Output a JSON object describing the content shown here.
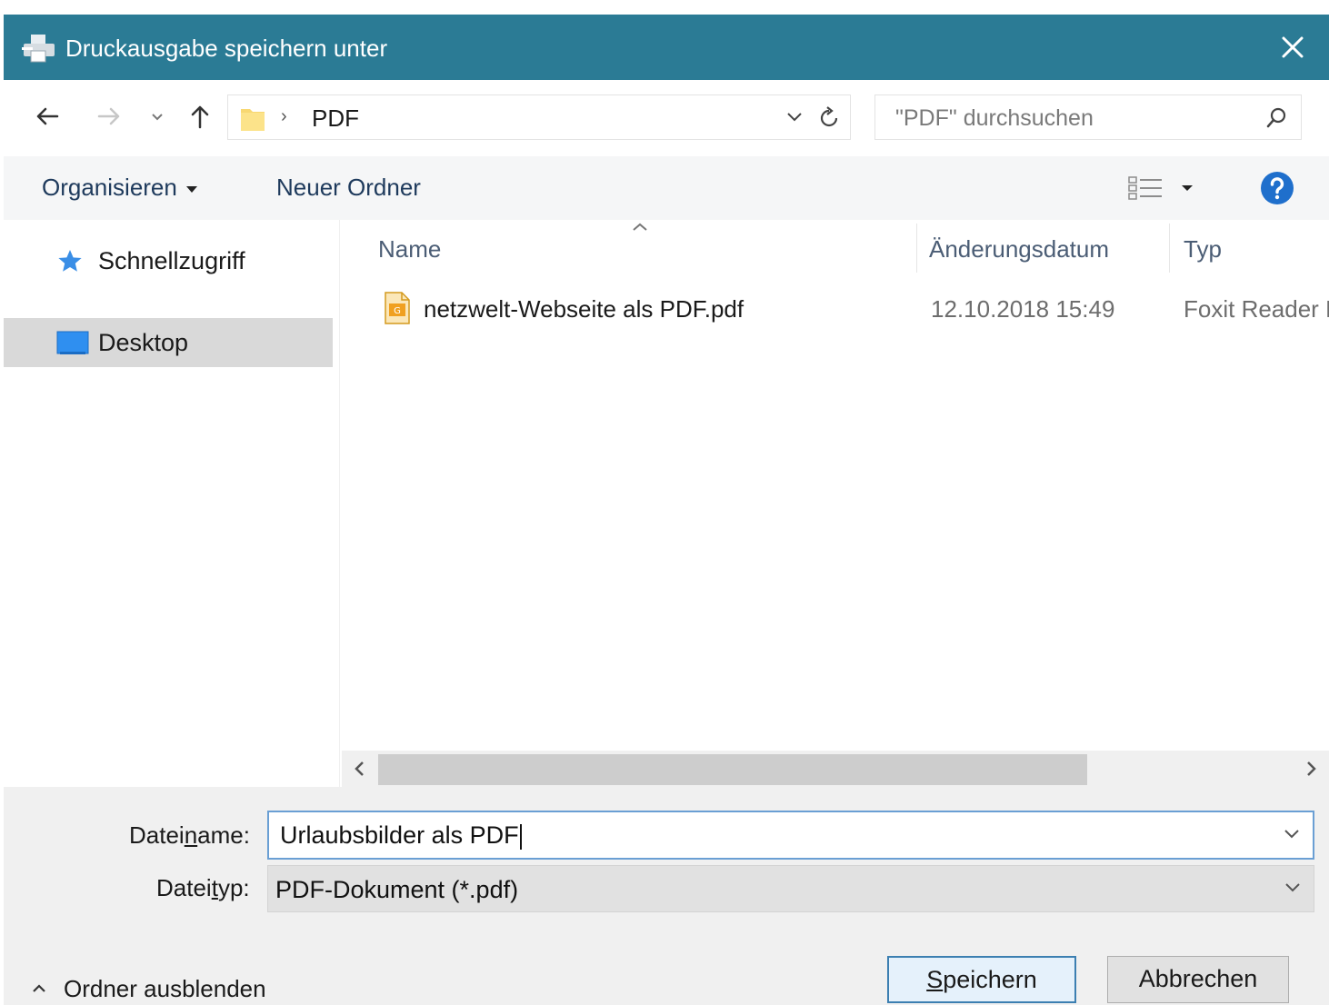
{
  "window": {
    "title": "Druckausgabe speichern unter",
    "accent_color": "#2b7b95"
  },
  "navbar": {
    "back_icon": "arrow-left-icon",
    "forward_icon": "arrow-right-icon",
    "recent_icon": "chevron-down-icon",
    "up_icon": "arrow-up-icon",
    "path_separator": "›",
    "path": "PDF",
    "search_placeholder": "\"PDF\" durchsuchen"
  },
  "commands": {
    "organize_label": "Organisieren",
    "new_folder_label": "Neuer Ordner"
  },
  "nav_pane": {
    "items": [
      {
        "label": "Schnellzugriff",
        "icon": "star-icon",
        "selected": false
      },
      {
        "label": "Desktop",
        "icon": "desktop-icon",
        "selected": true
      }
    ]
  },
  "file_list": {
    "columns": [
      "Name",
      "Änderungsdatum",
      "Typ"
    ],
    "sort_column": "Name",
    "rows": [
      {
        "name": "netzwelt-Webseite als PDF.pdf",
        "date": "12.10.2018 15:49",
        "type": "Foxit Reader PDF Document"
      }
    ]
  },
  "form": {
    "filename_label_pre": "Datei",
    "filename_label_accel": "n",
    "filename_label_post": "ame:",
    "filename_value": "Urlaubsbilder als PDF",
    "filetype_label_pre": "Datei",
    "filetype_label_accel": "t",
    "filetype_label_post": "yp:",
    "filetype_value": "PDF-Dokument (*.pdf)"
  },
  "footer": {
    "toggle_folders_label": "Ordner ausblenden",
    "save_label_accel": "S",
    "save_label_rest": "peichern",
    "cancel_label": "Abbrechen"
  }
}
